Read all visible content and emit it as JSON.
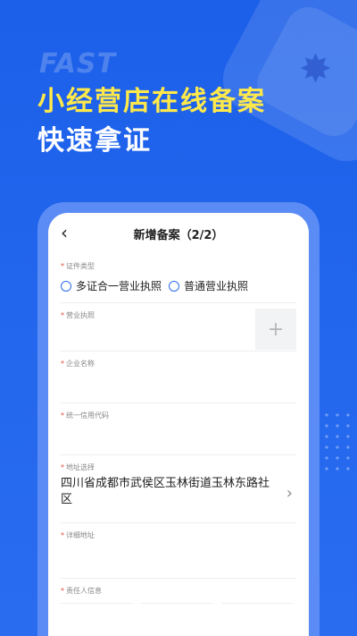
{
  "hero": {
    "fast_text": "FAST",
    "line1": "小经营店在线备案",
    "line2": "快速拿证",
    "colors": {
      "line1": "#ffe94a",
      "line2": "#ffffff",
      "background": "#1f63ea"
    }
  },
  "navbar": {
    "back_icon": "chevron-left-icon",
    "back_glyph": "‹",
    "title": "新增备案（2/2）"
  },
  "form": {
    "cert_type": {
      "label": "证件类型",
      "options": [
        "多证合一营业执照",
        "普通营业执照"
      ]
    },
    "business_license": {
      "label": "营业执照",
      "upload_glyph": "+"
    },
    "company_name": {
      "label": "企业名称"
    },
    "credit_code": {
      "label": "统一信用代码"
    },
    "address": {
      "label": "地址选择",
      "value": "四川省成都市武侯区玉林街道玉林东路社区",
      "chevron_glyph": "›"
    },
    "detail_address": {
      "label": "详细地址"
    },
    "responsible_person": {
      "label": "责任人信息"
    }
  }
}
